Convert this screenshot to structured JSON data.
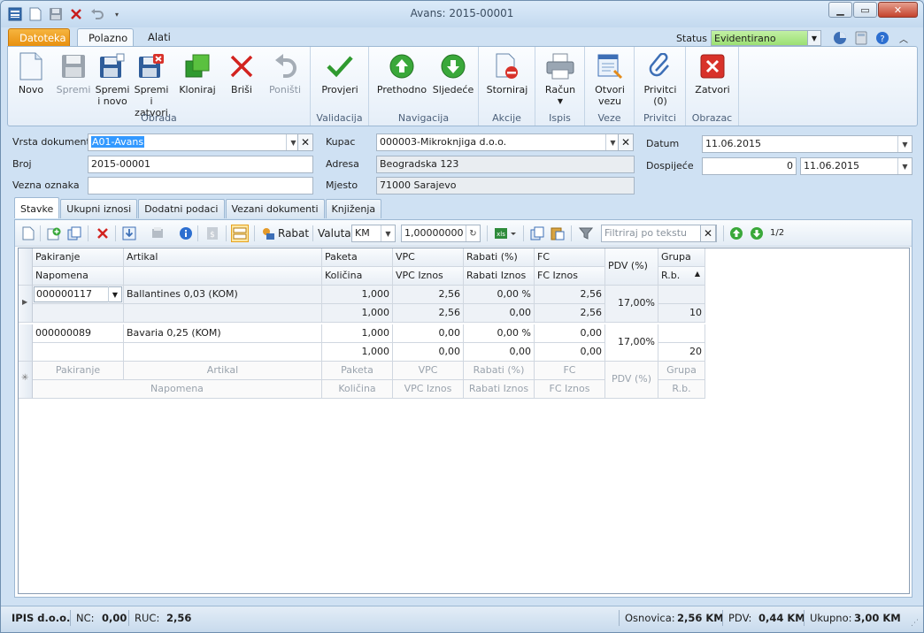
{
  "window": {
    "title": "Avans: 2015-00001"
  },
  "ribbon_tabs": {
    "file": "Datoteka",
    "home": "Polazno",
    "tools": "Alati"
  },
  "status": {
    "label": "Status",
    "value": "Evidentirano"
  },
  "ribbon": {
    "groups": {
      "obrada": "Obrada",
      "validacija": "Validacija",
      "navigacija": "Navigacija",
      "akcije": "Akcije",
      "ispis": "Ispis",
      "veze": "Veze",
      "privitci": "Privitci",
      "obrazac": "Obrazac"
    },
    "buttons": {
      "novo": "Novo",
      "spremi": "Spremi",
      "spremi_novo_1": "Spremi",
      "spremi_novo_2": "i novo",
      "spremi_zatvori_1": "Spremi i",
      "spremi_zatvori_2": "zatvori",
      "kloniraj": "Kloniraj",
      "brisi": "Briši",
      "ponisti": "Poništi",
      "provjeri": "Provjeri",
      "prethodno": "Prethodno",
      "sljedece": "Sljedeće",
      "storniraj": "Storniraj",
      "racun": "Račun",
      "otvori_1": "Otvori",
      "otvori_2": "vezu",
      "privitci_1": "Privitci",
      "privitci_2": "(0)",
      "zatvori": "Zatvori"
    }
  },
  "form": {
    "vrsta_label": "Vrsta dokumenta",
    "vrsta_value": "A01-Avans",
    "broj_label": "Broj",
    "broj_value": "2015-00001",
    "vezna_label": "Vezna oznaka",
    "vezna_value": "",
    "kupac_label": "Kupac",
    "kupac_value": "000003-Mikroknjiga d.o.o.",
    "adresa_label": "Adresa",
    "adresa_value": "Beogradska 123",
    "mjesto_label": "Mjesto",
    "mjesto_value": "71000 Sarajevo",
    "datum_label": "Datum",
    "datum_value": "11.06.2015",
    "dospijece_label": "Dospijeće",
    "dospijece_days": "0",
    "dospijece_date": "11.06.2015"
  },
  "detail_tabs": [
    "Stavke",
    "Ukupni iznosi",
    "Dodatni podaci",
    "Vezani dokumenti",
    "Knjiženja"
  ],
  "grid_toolbar": {
    "rabat": "Rabat",
    "valuta_label": "Valuta",
    "valuta_value": "KM",
    "rate": "1,00000000",
    "filter_placeholder": "Filtriraj po tekstu",
    "pager": "1/2"
  },
  "grid": {
    "headers_top": [
      "Pakiranje",
      "Artikal",
      "Paketa",
      "VPC",
      "Rabati (%)",
      "FC",
      "PDV (%)",
      "Grupa"
    ],
    "headers_bottom": [
      "Napomena",
      "Količina",
      "VPC Iznos",
      "Rabati Iznos",
      "FC Iznos",
      "R.b."
    ],
    "rows": [
      {
        "pakiranje": "000000117",
        "artikal": "Ballantines 0,03 (KOM)",
        "paketa": "1,000",
        "vpc": "2,56",
        "rabati": "0,00 %",
        "fc": "2,56",
        "pdv": "17,00%",
        "grupa": "",
        "napomena": "",
        "kolicina": "1,000",
        "vpc_iznos": "2,56",
        "rabati_iznos": "0,00",
        "fc_iznos": "2,56",
        "rb": "10"
      },
      {
        "pakiranje": "000000089",
        "artikal": "Bavaria 0,25 (KOM)",
        "paketa": "1,000",
        "vpc": "0,00",
        "rabati": "0,00 %",
        "fc": "0,00",
        "pdv": "17,00%",
        "grupa": "",
        "napomena": "",
        "kolicina": "1,000",
        "vpc_iznos": "0,00",
        "rabati_iznos": "0,00",
        "fc_iznos": "0,00",
        "rb": "20"
      }
    ]
  },
  "statusbar": {
    "company": "IPIS d.o.o.",
    "nc_label": "NC:",
    "nc_value": "0,00",
    "ruc_label": "RUC:",
    "ruc_value": "2,56",
    "osnovica_label": "Osnovica:",
    "osnovica_value": "2,56 KM",
    "pdv_label": "PDV:",
    "pdv_value": "0,44 KM",
    "ukupno_label": "Ukupno:",
    "ukupno_value": "3,00 KM"
  }
}
